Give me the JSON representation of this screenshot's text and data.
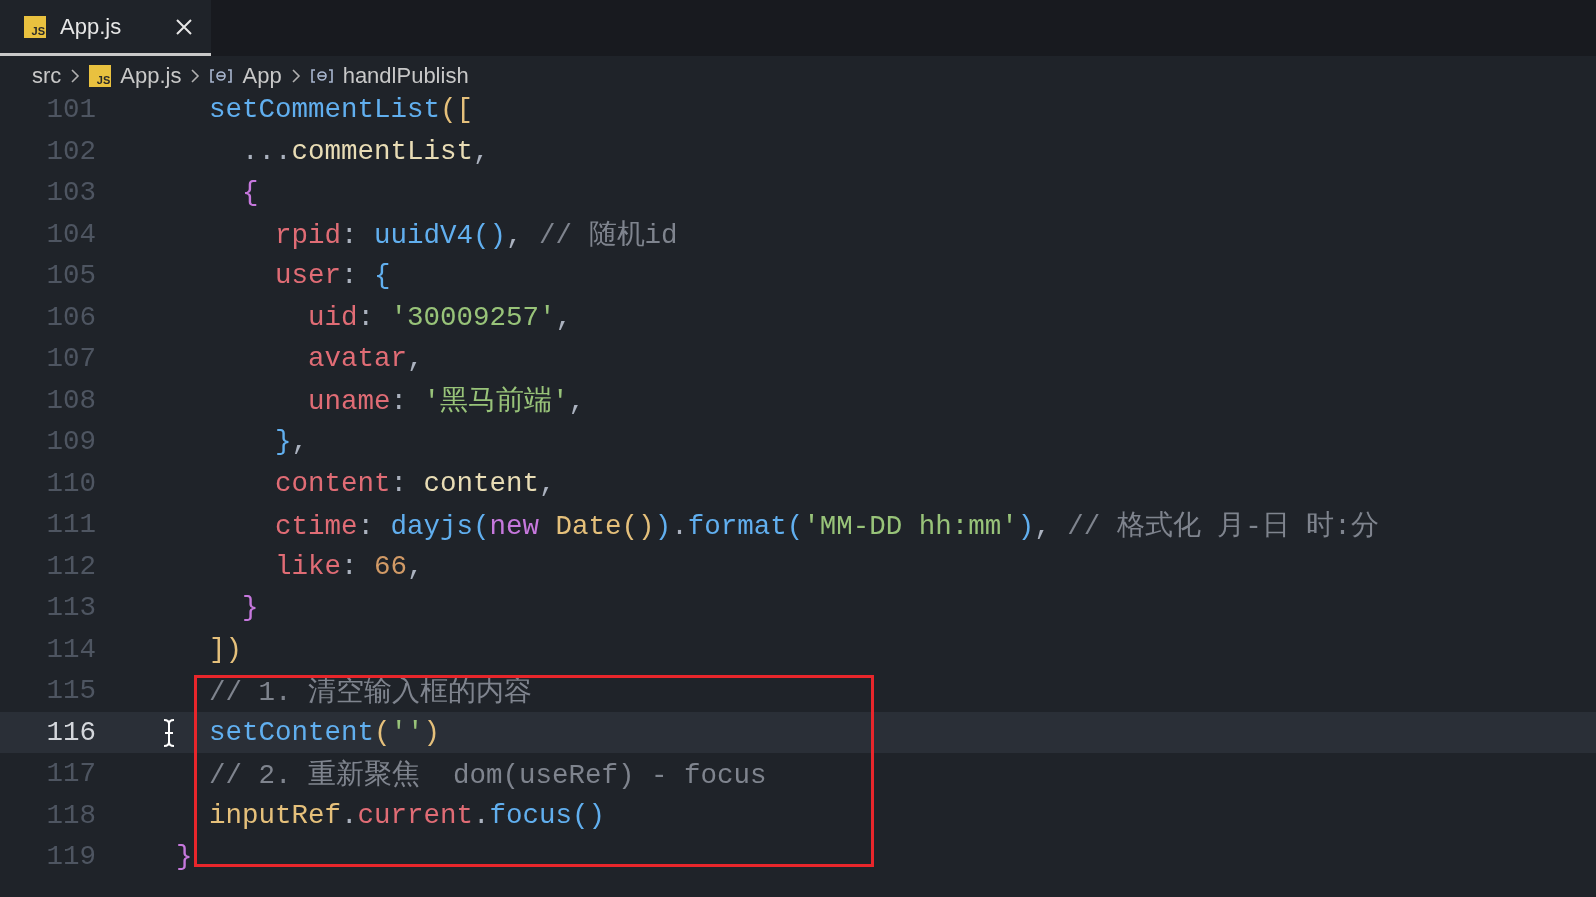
{
  "tabs": [
    {
      "label": "App.js",
      "badge": "JS",
      "selected": true
    }
  ],
  "breadcrumbs": [
    {
      "kind": "folder",
      "label": "src"
    },
    {
      "kind": "file",
      "label": "App.js",
      "badge": "JS"
    },
    {
      "kind": "symbol",
      "label": "App"
    },
    {
      "kind": "symbol",
      "label": "handlPublish"
    }
  ],
  "lines": [
    {
      "number": "101",
      "current": false,
      "boxed": false,
      "tokens": [
        {
          "kind": "function",
          "text": "  setCommentList"
        },
        {
          "kind": "bracket1",
          "text": "(["
        }
      ]
    },
    {
      "number": "102",
      "current": false,
      "boxed": false,
      "tokens": [
        {
          "kind": "plain",
          "text": "    ..."
        },
        {
          "kind": "variable",
          "text": "commentList"
        },
        {
          "kind": "plain",
          "text": ","
        }
      ]
    },
    {
      "number": "103",
      "current": false,
      "boxed": false,
      "tokens": [
        {
          "kind": "bracket2",
          "text": "    {"
        }
      ]
    },
    {
      "number": "104",
      "current": false,
      "boxed": false,
      "tokens": [
        {
          "kind": "property",
          "text": "      rpid"
        },
        {
          "kind": "plain",
          "text": ": "
        },
        {
          "kind": "function",
          "text": "uuidV4"
        },
        {
          "kind": "bracket3",
          "text": "()"
        },
        {
          "kind": "plain",
          "text": ", "
        },
        {
          "kind": "comment",
          "text": "// 随机id"
        }
      ]
    },
    {
      "number": "105",
      "current": false,
      "boxed": false,
      "tokens": [
        {
          "kind": "property",
          "text": "      user"
        },
        {
          "kind": "plain",
          "text": ": "
        },
        {
          "kind": "bracket3",
          "text": "{"
        }
      ]
    },
    {
      "number": "106",
      "current": false,
      "boxed": false,
      "tokens": [
        {
          "kind": "property",
          "text": "        uid"
        },
        {
          "kind": "plain",
          "text": ": "
        },
        {
          "kind": "string",
          "text": "'30009257'"
        },
        {
          "kind": "plain",
          "text": ","
        }
      ]
    },
    {
      "number": "107",
      "current": false,
      "boxed": false,
      "tokens": [
        {
          "kind": "property",
          "text": "        avatar"
        },
        {
          "kind": "plain",
          "text": ","
        }
      ]
    },
    {
      "number": "108",
      "current": false,
      "boxed": false,
      "tokens": [
        {
          "kind": "property",
          "text": "        uname"
        },
        {
          "kind": "plain",
          "text": ": "
        },
        {
          "kind": "string",
          "text": "'黑马前端'"
        },
        {
          "kind": "plain",
          "text": ","
        }
      ]
    },
    {
      "number": "109",
      "current": false,
      "boxed": false,
      "tokens": [
        {
          "kind": "bracket3",
          "text": "      }"
        },
        {
          "kind": "plain",
          "text": ","
        }
      ]
    },
    {
      "number": "110",
      "current": false,
      "boxed": false,
      "tokens": [
        {
          "kind": "property",
          "text": "      content"
        },
        {
          "kind": "plain",
          "text": ": "
        },
        {
          "kind": "variable",
          "text": "content"
        },
        {
          "kind": "plain",
          "text": ","
        }
      ]
    },
    {
      "number": "111",
      "current": false,
      "boxed": false,
      "tokens": [
        {
          "kind": "property",
          "text": "      ctime"
        },
        {
          "kind": "plain",
          "text": ": "
        },
        {
          "kind": "function",
          "text": "dayjs"
        },
        {
          "kind": "bracket3",
          "text": "("
        },
        {
          "kind": "keyword",
          "text": "new "
        },
        {
          "kind": "type",
          "text": "Date"
        },
        {
          "kind": "bracket1",
          "text": "()"
        },
        {
          "kind": "bracket3",
          "text": ")"
        },
        {
          "kind": "plain",
          "text": "."
        },
        {
          "kind": "function",
          "text": "format"
        },
        {
          "kind": "bracket3",
          "text": "("
        },
        {
          "kind": "string",
          "text": "'MM-DD hh:mm'"
        },
        {
          "kind": "bracket3",
          "text": ")"
        },
        {
          "kind": "plain",
          "text": ", "
        },
        {
          "kind": "comment",
          "text": "// 格式化 月-日 时:分"
        }
      ]
    },
    {
      "number": "112",
      "current": false,
      "boxed": false,
      "tokens": [
        {
          "kind": "property",
          "text": "      like"
        },
        {
          "kind": "plain",
          "text": ": "
        },
        {
          "kind": "number",
          "text": "66"
        },
        {
          "kind": "plain",
          "text": ","
        }
      ]
    },
    {
      "number": "113",
      "current": false,
      "boxed": false,
      "tokens": [
        {
          "kind": "bracket2",
          "text": "    }"
        }
      ]
    },
    {
      "number": "114",
      "current": false,
      "boxed": false,
      "tokens": [
        {
          "kind": "bracket1",
          "text": "  ])"
        }
      ]
    },
    {
      "number": "115",
      "current": false,
      "boxed": true,
      "tokens": [
        {
          "kind": "comment",
          "text": "  // 1. 清空输入框的内容"
        }
      ]
    },
    {
      "number": "116",
      "current": true,
      "boxed": true,
      "tokens": [
        {
          "kind": "function",
          "text": "  setContent"
        },
        {
          "kind": "bracket1",
          "text": "("
        },
        {
          "kind": "string",
          "text": "''"
        },
        {
          "kind": "bracket1",
          "text": ")"
        }
      ]
    },
    {
      "number": "117",
      "current": false,
      "boxed": true,
      "tokens": [
        {
          "kind": "comment",
          "text": "  // 2. 重新聚焦  dom(useRef) - focus"
        }
      ]
    },
    {
      "number": "118",
      "current": false,
      "boxed": true,
      "tokens": [
        {
          "kind": "type",
          "text": "  inputRef"
        },
        {
          "kind": "plain",
          "text": "."
        },
        {
          "kind": "property",
          "text": "current"
        },
        {
          "kind": "plain",
          "text": "."
        },
        {
          "kind": "function",
          "text": "focus"
        },
        {
          "kind": "bracket3",
          "text": "()"
        }
      ]
    },
    {
      "number": "119",
      "current": false,
      "boxed": false,
      "tokens": [
        {
          "kind": "bracket2",
          "text": "}"
        }
      ]
    }
  ]
}
